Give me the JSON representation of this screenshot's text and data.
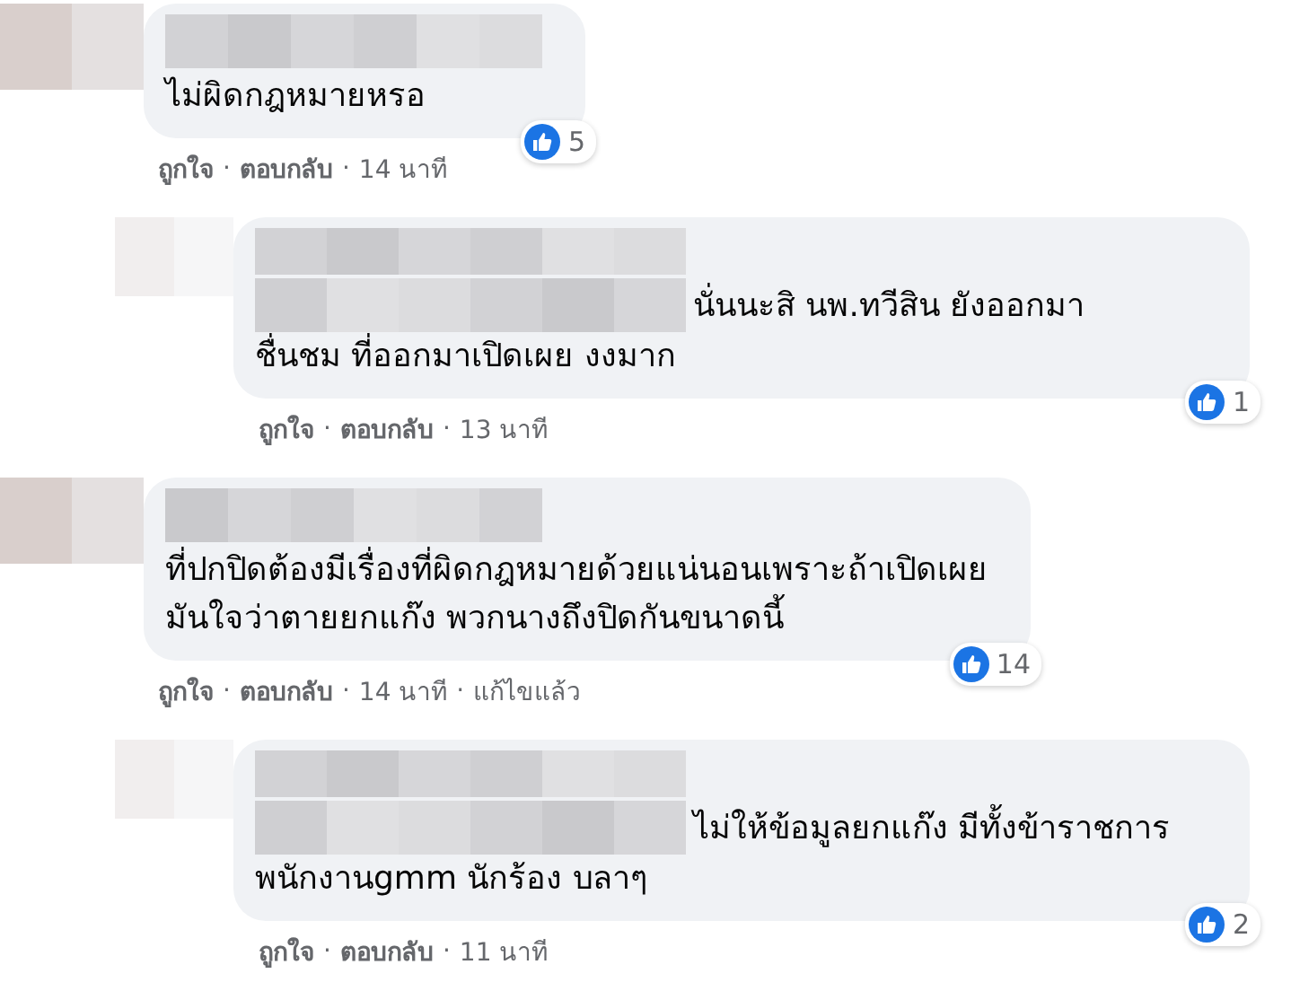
{
  "separator": "·",
  "comments": [
    {
      "lines": [
        "ไม่ผิดกฎหมายหรอ"
      ],
      "likes": "5",
      "actions": [
        "ถูกใจ",
        "ตอบกลับ"
      ],
      "time": "14 นาที",
      "children": [
        {
          "lines": [
            "นั่นนะสิ นพ.ทวีสิน ยังออกมา",
            "ชื่นชม ที่ออกมาเปิดเผย งงมาก"
          ],
          "likes": "1",
          "actions": [
            "ถูกใจ",
            "ตอบกลับ"
          ],
          "time": "13 นาที"
        }
      ]
    },
    {
      "lines": [
        "ที่ปกปิดต้องมีเรื่องที่ผิดกฎหมายด้วยแน่นอนเพราะถ้าเปิดเผย",
        "มันใจว่าตายยกแก๊ง พวกนางถึงปิดกันขนาดนี้"
      ],
      "likes": "14",
      "actions": [
        "ถูกใจ",
        "ตอบกลับ"
      ],
      "time": "14 นาที",
      "edited": "แก้ไขแล้ว",
      "children": [
        {
          "lines": [
            "ไม่ให้ข้อมูลยกแก๊ง มีทั้งข้าราชการ",
            "พนักงานgmm นักร้อง บลาๆ"
          ],
          "likes": "2",
          "actions": [
            "ถูกใจ",
            "ตอบกลับ"
          ],
          "time": "11 นาที"
        }
      ]
    }
  ]
}
